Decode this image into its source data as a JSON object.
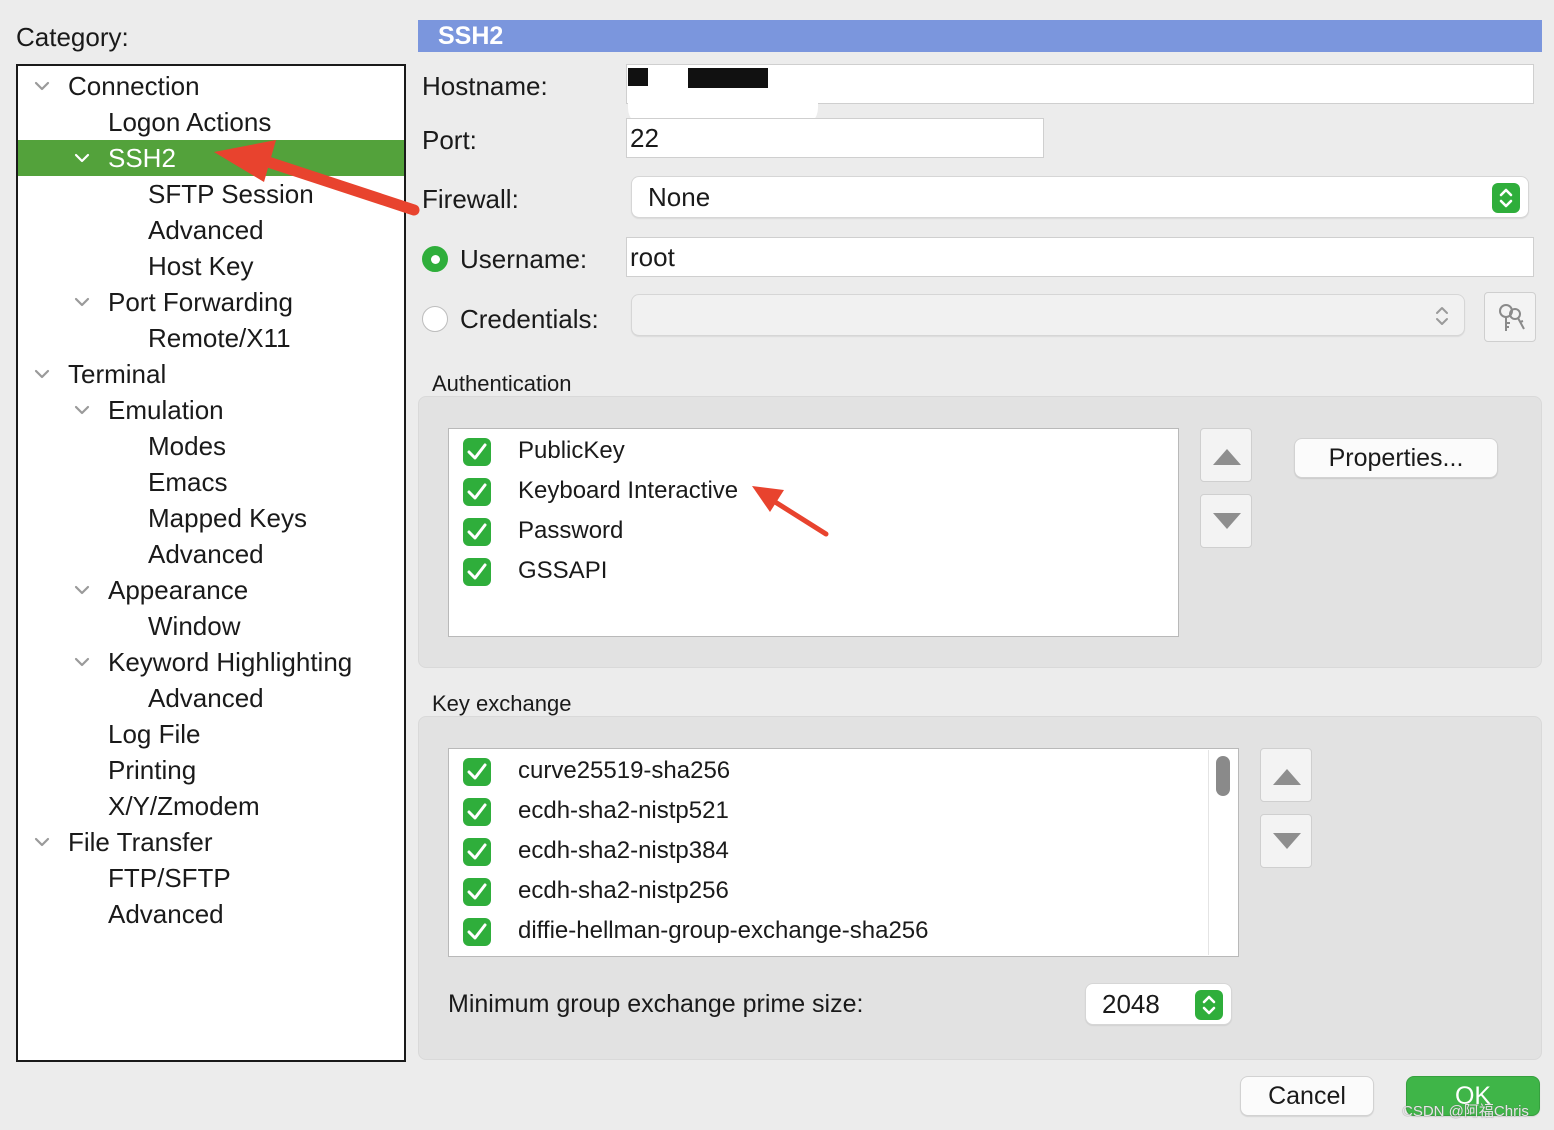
{
  "sidebar": {
    "category_label": "Category:",
    "items": [
      {
        "label": "Connection",
        "level": 0,
        "expandable": true,
        "selected": false
      },
      {
        "label": "Logon Actions",
        "level": 1,
        "expandable": false,
        "selected": false
      },
      {
        "label": "SSH2",
        "level": 1,
        "expandable": true,
        "selected": true
      },
      {
        "label": "SFTP Session",
        "level": 2,
        "expandable": false,
        "selected": false
      },
      {
        "label": "Advanced",
        "level": 2,
        "expandable": false,
        "selected": false
      },
      {
        "label": "Host Key",
        "level": 2,
        "expandable": false,
        "selected": false
      },
      {
        "label": "Port Forwarding",
        "level": 1,
        "expandable": true,
        "selected": false
      },
      {
        "label": "Remote/X11",
        "level": 2,
        "expandable": false,
        "selected": false
      },
      {
        "label": "Terminal",
        "level": 0,
        "expandable": true,
        "selected": false
      },
      {
        "label": "Emulation",
        "level": 1,
        "expandable": true,
        "selected": false
      },
      {
        "label": "Modes",
        "level": 2,
        "expandable": false,
        "selected": false
      },
      {
        "label": "Emacs",
        "level": 2,
        "expandable": false,
        "selected": false
      },
      {
        "label": "Mapped Keys",
        "level": 2,
        "expandable": false,
        "selected": false
      },
      {
        "label": "Advanced",
        "level": 2,
        "expandable": false,
        "selected": false
      },
      {
        "label": "Appearance",
        "level": 1,
        "expandable": true,
        "selected": false
      },
      {
        "label": "Window",
        "level": 2,
        "expandable": false,
        "selected": false
      },
      {
        "label": "Keyword Highlighting",
        "level": 1,
        "expandable": true,
        "selected": false
      },
      {
        "label": "Advanced",
        "level": 2,
        "expandable": false,
        "selected": false
      },
      {
        "label": "Log File",
        "level": 1,
        "expandable": false,
        "selected": false
      },
      {
        "label": "Printing",
        "level": 1,
        "expandable": false,
        "selected": false
      },
      {
        "label": "X/Y/Zmodem",
        "level": 1,
        "expandable": false,
        "selected": false
      },
      {
        "label": "File Transfer",
        "level": 0,
        "expandable": true,
        "selected": false
      },
      {
        "label": "FTP/SFTP",
        "level": 1,
        "expandable": false,
        "selected": false
      },
      {
        "label": "Advanced",
        "level": 1,
        "expandable": false,
        "selected": false
      }
    ]
  },
  "panel": {
    "title": "SSH2",
    "hostname_label": "Hostname:",
    "hostname_value": "",
    "port_label": "Port:",
    "port_value": "22",
    "firewall_label": "Firewall:",
    "firewall_value": "None",
    "username_label": "Username:",
    "username_value": "root",
    "credentials_label": "Credentials:",
    "credentials_value": ""
  },
  "authentication": {
    "title": "Authentication",
    "methods": [
      {
        "label": "PublicKey",
        "checked": true
      },
      {
        "label": "Keyboard Interactive",
        "checked": true
      },
      {
        "label": "Password",
        "checked": true
      },
      {
        "label": "GSSAPI",
        "checked": true
      }
    ],
    "properties_label": "Properties..."
  },
  "key_exchange": {
    "title": "Key exchange",
    "algorithms": [
      {
        "label": "curve25519-sha256",
        "checked": true
      },
      {
        "label": "ecdh-sha2-nistp521",
        "checked": true
      },
      {
        "label": "ecdh-sha2-nistp384",
        "checked": true
      },
      {
        "label": "ecdh-sha2-nistp256",
        "checked": true
      },
      {
        "label": "diffie-hellman-group-exchange-sha256",
        "checked": true
      }
    ],
    "min_prime_label": "Minimum group exchange prime size:",
    "min_prime_value": "2048"
  },
  "footer": {
    "cancel_label": "Cancel",
    "ok_label": "OK"
  },
  "watermark": "CSDN @阿福Chris",
  "colors": {
    "selection_green": "#53a23b",
    "checkbox_green": "#2fae3b",
    "header_blue": "#7b96dd",
    "annotation_red": "#e8432e"
  }
}
